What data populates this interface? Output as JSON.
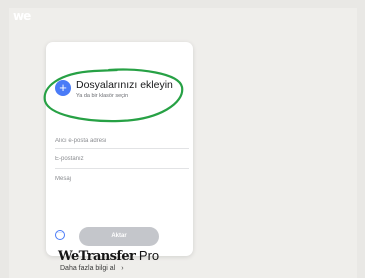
{
  "logo": "we",
  "upload": {
    "add_icon": "+",
    "title": "Dosyalarınızı ekleyin",
    "subtitle": "Ya da bir klasör seçin"
  },
  "form": {
    "recipient_placeholder": "Alıcı e-posta adresi",
    "sender_placeholder": "E-postanız",
    "message_placeholder": "Mesaj"
  },
  "actions": {
    "options_icon": "···",
    "transfer_label": "Aktar"
  },
  "footer": {
    "brand_name": "WeTransfer",
    "brand_suffix": "Pro",
    "learn_more": "Daha fazla bilgi al",
    "learn_more_arrow": "›"
  },
  "colors": {
    "accent": "#4a7bf7",
    "highlight_circle": "#27a145",
    "button_disabled": "#c4c6cb"
  },
  "icons": {
    "add": "plus-icon",
    "options": "more-options-icon",
    "arrow": "chevron-right-icon"
  }
}
